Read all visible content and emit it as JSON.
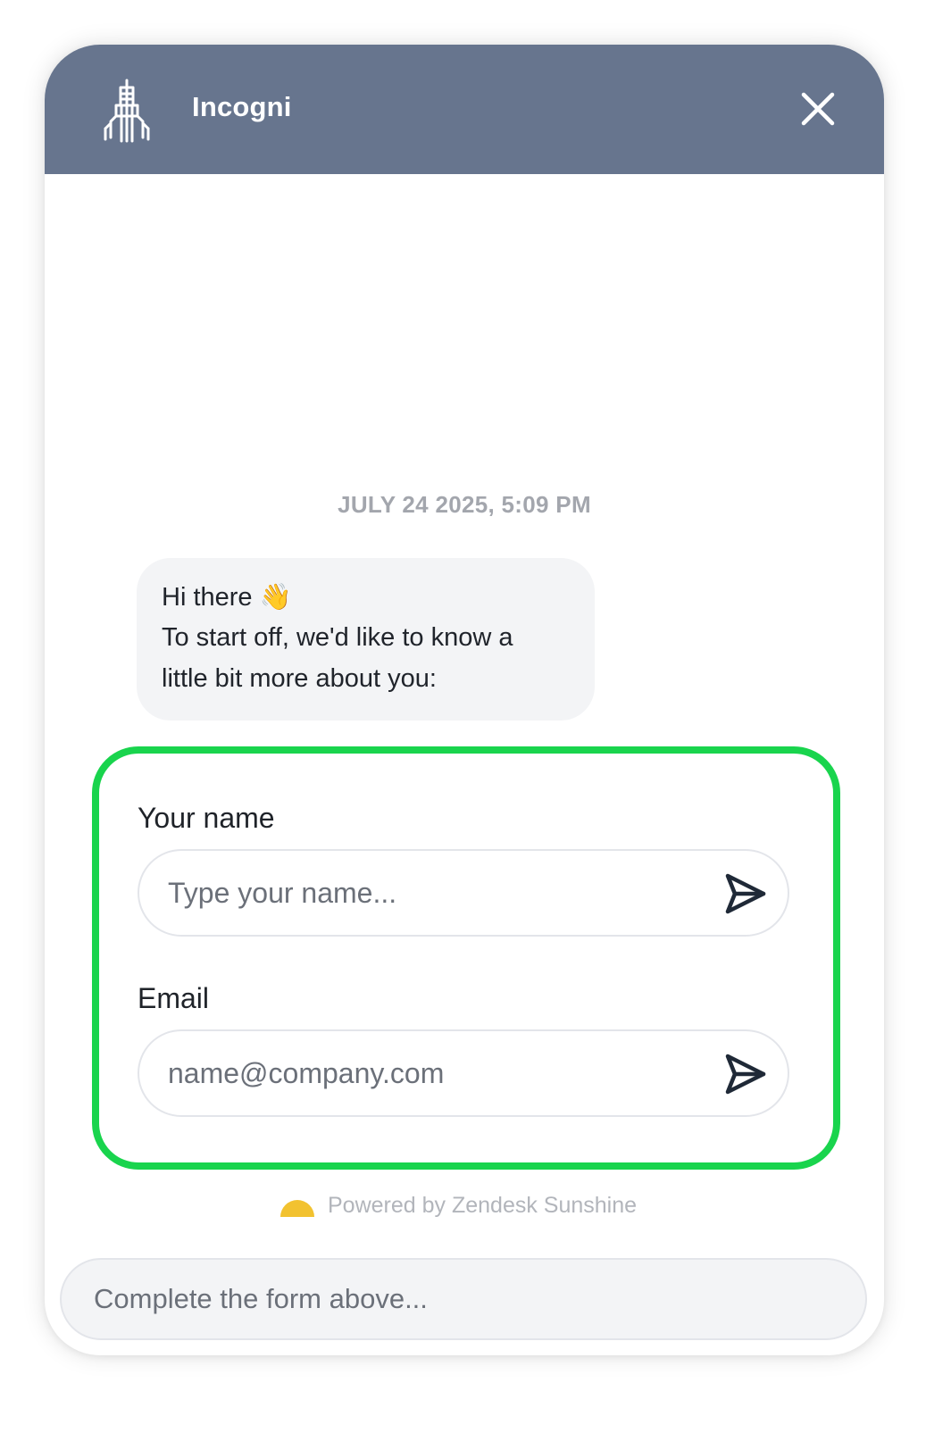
{
  "header": {
    "title": "Incogni",
    "logo_icon": "skyscraper-logo",
    "close_icon": "close-icon",
    "background_color": "#67758e"
  },
  "conversation": {
    "timestamp": "JULY 24 2025, 5:09 PM",
    "message": {
      "line1": "Hi there 👋",
      "line2": "To start off, we'd like to know a",
      "line3": "little bit more about you:"
    }
  },
  "form": {
    "highlight_color": "#19d44d",
    "name_field": {
      "label": "Your name",
      "placeholder": "Type your name...",
      "value": "",
      "send_icon": "send-arrow-icon"
    },
    "email_field": {
      "label": "Email",
      "placeholder": "name@company.com",
      "value": "",
      "send_icon": "send-arrow-icon"
    }
  },
  "footer": {
    "powered_by": "Powered by Zendesk Sunshine",
    "brand_icon": "zendesk-sun-icon",
    "composer_placeholder": "Complete the form above..."
  }
}
